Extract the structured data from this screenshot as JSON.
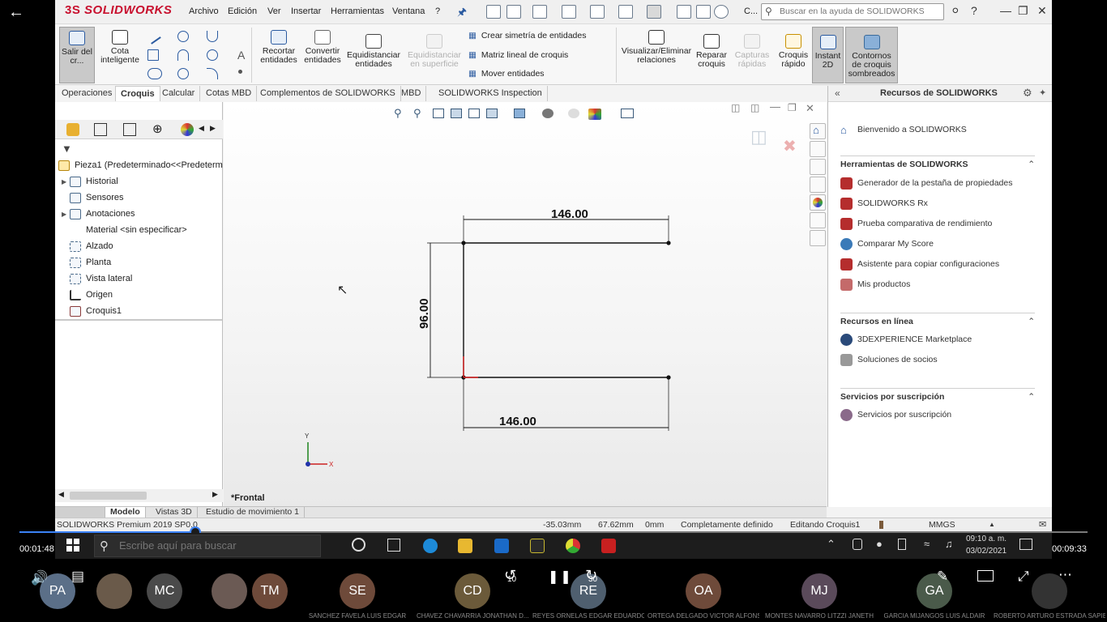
{
  "app": {
    "name": "SOLIDWORKS",
    "logo_mark": "3S"
  },
  "menu": [
    "Archivo",
    "Edición",
    "Ver",
    "Insertar",
    "Herramientas",
    "Ventana",
    "?"
  ],
  "quickbar": {
    "c_label": "C..."
  },
  "search": {
    "placeholder": "Buscar en la ayuda de SOLIDWORKS"
  },
  "ribbon": {
    "exit_sketch": "Salir del cr...",
    "smart_dim": "Cota inteligente",
    "trim": "Recortar entidades",
    "convert": "Convertir entidades",
    "offset": "Equidistanciar entidades",
    "offset_surface": "Equidistanciar en superficie",
    "mirror": "Crear simetría de entidades",
    "linear_pattern": "Matriz lineal de croquis",
    "move": "Mover entidades",
    "relations": "Visualizar/Eliminar relaciones",
    "repair": "Reparar croquis",
    "quick_snaps": "Capturas rápidas",
    "rapid_sketch": "Croquis rápido",
    "instant2d": "Instant 2D",
    "shaded": "Contornos de croquis sombreados"
  },
  "tabs": [
    "Operaciones",
    "Croquis",
    "Calcular",
    "Cotas MBD",
    "Complementos de SOLIDWORKS",
    "MBD",
    "SOLIDWORKS Inspection"
  ],
  "tree": {
    "root": "Pieza1  (Predeterminado<<Predeterm",
    "items": [
      "Historial",
      "Sensores",
      "Anotaciones",
      "Material <sin especificar>",
      "Alzado",
      "Planta",
      "Vista lateral",
      "Origen",
      "Croquis1"
    ]
  },
  "sketch": {
    "dim_top": "146.00",
    "dim_bottom": "146.00",
    "dim_left": "96.00",
    "view_name": "*Frontal",
    "axis_y": "Y",
    "axis_x": "X"
  },
  "resources": {
    "title": "Recursos de SOLIDWORKS",
    "welcome": "Bienvenido a SOLIDWORKS",
    "tools_header": "Herramientas de SOLIDWORKS",
    "tools": [
      "Generador de la pestaña de propiedades",
      "SOLIDWORKS Rx",
      "Prueba comparativa de rendimiento",
      "Comparar My Score",
      "Asistente para copiar configuraciones",
      "Mis productos"
    ],
    "online_header": "Recursos en línea",
    "online": [
      "3DEXPERIENCE Marketplace",
      "Soluciones de socios"
    ],
    "subs_header": "Servicios por suscripción",
    "subs": [
      "Servicios por suscripción"
    ]
  },
  "bottom_tabs": [
    "Modelo",
    "Vistas 3D",
    "Estudio de movimiento 1"
  ],
  "status": {
    "version": "SOLIDWORKS Premium 2019 SP0.0",
    "x": "-35.03mm",
    "y": "67.62mm",
    "z": "0mm",
    "state": "Completamente definido",
    "editing": "Editando Croquis1",
    "units": "MMGS"
  },
  "taskbar": {
    "search_placeholder": "Escribe aquí para buscar",
    "time": "09:10 a. m.",
    "date": "03/02/2021"
  },
  "video": {
    "elapsed": "00:01:48",
    "total": "00:09:33",
    "progress": 0.165,
    "skip_back": "10",
    "skip_fwd": "30"
  },
  "participants": [
    {
      "initials": "PA",
      "name": "",
      "color": "#5b6f88"
    },
    {
      "initials": "",
      "name": "",
      "color": "#6a5a4a"
    },
    {
      "initials": "MC",
      "name": "",
      "color": "#4a4a4a"
    },
    {
      "initials": "",
      "name": "",
      "color": "#6b5a54"
    },
    {
      "initials": "TM",
      "name": "",
      "color": "#6e4a3a"
    },
    {
      "initials": "SE",
      "name": "SANCHEZ FAVELA LUIS EDGAR",
      "color": "#6e4a3a"
    },
    {
      "initials": "CD",
      "name": "CHAVEZ  CHAVARRIA  JONATHAN D...",
      "color": "#6b5a3a"
    },
    {
      "initials": "RE",
      "name": "REYES ORNELAS EDGAR EDUARDO",
      "color": "#4f5f6f"
    },
    {
      "initials": "OA",
      "name": "ORTEGA DELGADO VICTOR ALFONSO",
      "color": "#6e4a3a"
    },
    {
      "initials": "MJ",
      "name": "MONTES NAVARRO LITZZI JANETH",
      "color": "#5a4a5a"
    },
    {
      "initials": "GA",
      "name": "GARCIA MIJANGOS LUIS ALDAIR",
      "color": "#4a5a4a"
    },
    {
      "initials": "",
      "name": "ROBERTO ARTURO ESTRADA SAPIEN",
      "color": "#333333"
    }
  ]
}
